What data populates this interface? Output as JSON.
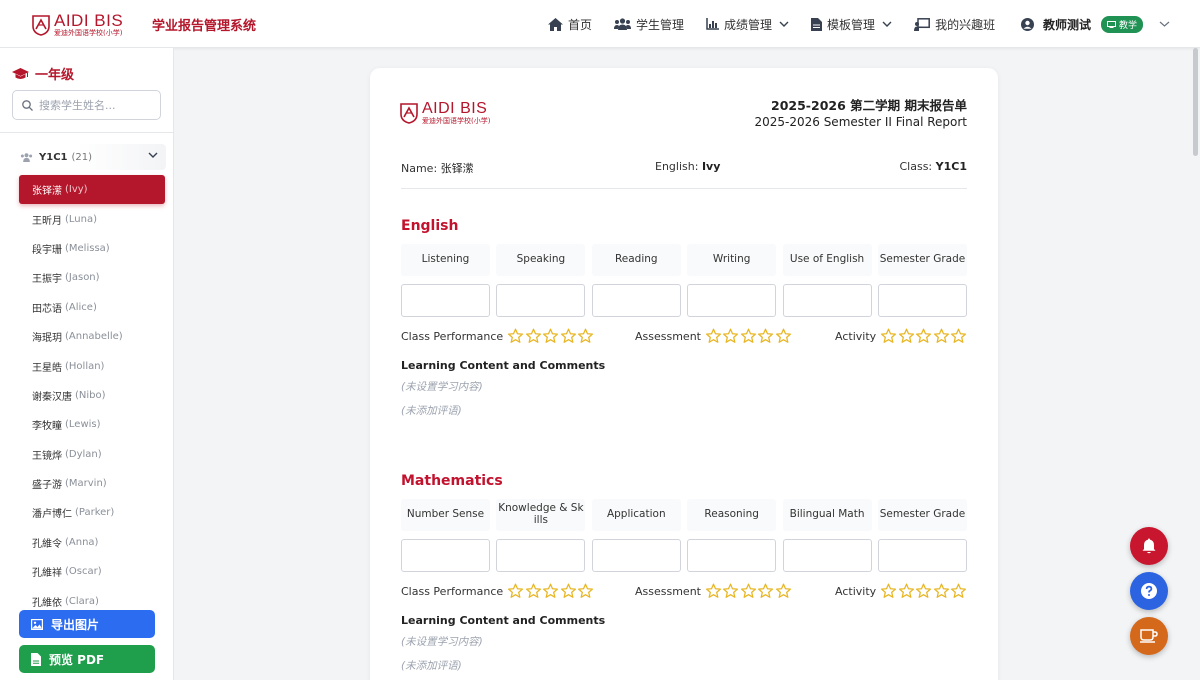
{
  "header": {
    "logo_text": "AIDI BIS",
    "logo_sub": "爱迪外国语学校(小学)",
    "system_title": "学业报告管理系统",
    "nav": [
      {
        "label": "首页",
        "icon": "home-icon"
      },
      {
        "label": "学生管理",
        "icon": "users-icon"
      },
      {
        "label": "成绩管理",
        "icon": "chart-icon"
      },
      {
        "label": "模板管理",
        "icon": "file-icon"
      },
      {
        "label": "我的兴趣班",
        "icon": "chalkboard-icon"
      }
    ],
    "user_name": "教师测试",
    "role_badge": "教学"
  },
  "sidebar": {
    "grade_label": "一年级",
    "search_placeholder": "搜索学生姓名...",
    "class_name": "Y1C1",
    "class_count": "(21)",
    "students": [
      {
        "cn": "张铎潆",
        "en": "(Ivy)",
        "active": true
      },
      {
        "cn": "王昕月",
        "en": "(Luna)"
      },
      {
        "cn": "段宇珊",
        "en": "(Melissa)"
      },
      {
        "cn": "王振宇",
        "en": "(Jason)"
      },
      {
        "cn": "田芯语",
        "en": "(Alice)"
      },
      {
        "cn": "海珉玥",
        "en": "(Annabelle)"
      },
      {
        "cn": "王星皓",
        "en": "(Hollan)"
      },
      {
        "cn": "谢秦汉唐",
        "en": "(Nibo)"
      },
      {
        "cn": "李牧瞳",
        "en": "(Lewis)"
      },
      {
        "cn": "王镜烨",
        "en": "(Dylan)"
      },
      {
        "cn": "盛子游",
        "en": "(Marvin)"
      },
      {
        "cn": "潘卢博仁",
        "en": "(Parker)"
      },
      {
        "cn": "孔維令",
        "en": "(Anna)"
      },
      {
        "cn": "孔維祥",
        "en": "(Oscar)"
      },
      {
        "cn": "孔維依",
        "en": "(Clara)"
      }
    ],
    "export_label": "导出图片",
    "pdf_label": "预览 PDF"
  },
  "report": {
    "title_cn": "2025-2026 第二学期 期末报告单",
    "title_en": "2025-2026 Semester II Final Report",
    "name_label": "Name:",
    "name_value": "张铎潆",
    "english_label": "English:",
    "english_value": "Ivy",
    "class_label": "Class:",
    "class_value": "Y1C1",
    "subjects": [
      {
        "title": "English",
        "skills": [
          "Listening",
          "Speaking",
          "Reading",
          "Writing",
          "Use of English",
          "Semester Grade"
        ],
        "ratings": [
          {
            "label": "Class Performance",
            "stars": 0
          },
          {
            "label": "Assessment",
            "stars": 0
          },
          {
            "label": "Activity",
            "stars": 0
          }
        ],
        "comments_title": "Learning Content and Comments",
        "content_placeholder": "(未设置学习内容)",
        "comment_placeholder": "(未添加评语)"
      },
      {
        "title": "Mathematics",
        "skills": [
          "Number Sense",
          "Knowledge & Sk ills",
          "Application",
          "Reasoning",
          "Bilingual Math",
          "Semester Grade"
        ],
        "ratings": [
          {
            "label": "Class Performance",
            "stars": 0
          },
          {
            "label": "Assessment",
            "stars": 0
          },
          {
            "label": "Activity",
            "stars": 0
          }
        ],
        "comments_title": "Learning Content and Comments",
        "content_placeholder": "(未设置学习内容)",
        "comment_placeholder": "(未添加评语)"
      }
    ]
  },
  "colors": {
    "brand_red": "#b4162b",
    "star_gold": "#e8b623",
    "export_blue": "#2b6cf0",
    "pdf_green": "#1f9e4b"
  }
}
